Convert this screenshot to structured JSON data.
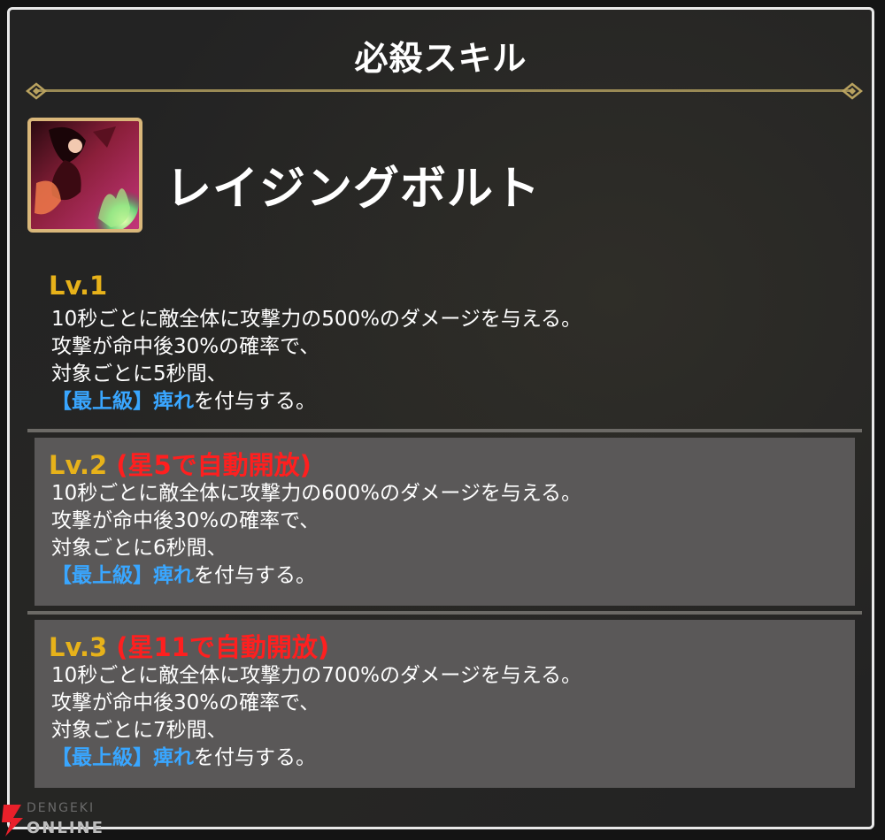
{
  "header": {
    "title": "必殺スキル"
  },
  "skill": {
    "name": "レイジングボルト"
  },
  "levels": [
    {
      "level_label": "Lv.1",
      "unlock_note": "",
      "lines": [
        "10秒ごとに敵全体に攻撃力の500%のダメージを与える。",
        "攻撃が命中後30%の確率で、",
        "対象ごとに5秒間、"
      ],
      "effect_grade": "【最上級】",
      "effect_name": "痺れ",
      "effect_suffix": "を付与する。"
    },
    {
      "level_label": "Lv.2",
      "unlock_note": "(星5で自動開放)",
      "lines": [
        "10秒ごとに敵全体に攻撃力の600%のダメージを与える。",
        "攻撃が命中後30%の確率で、",
        "対象ごとに6秒間、"
      ],
      "effect_grade": "【最上級】",
      "effect_name": "痺れ",
      "effect_suffix": "を付与する。"
    },
    {
      "level_label": "Lv.3",
      "unlock_note": "(星11で自動開放)",
      "lines": [
        "10秒ごとに敵全体に攻撃力の700%のダメージを与える。",
        "攻撃が命中後30%の確率で、",
        "対象ごとに7秒間、"
      ],
      "effect_grade": "【最上級】",
      "effect_name": "痺れ",
      "effect_suffix": "を付与する。"
    }
  ],
  "watermark": {
    "line1": "DENGEKI",
    "line2": "ONLINE",
    "icon": "lightning-bolt-icon"
  },
  "colors": {
    "level_label": "#e7b21a",
    "unlock_note": "#ff1f1f",
    "effect_keyword": "#39a6ff",
    "locked_panel": "#5a5858"
  }
}
